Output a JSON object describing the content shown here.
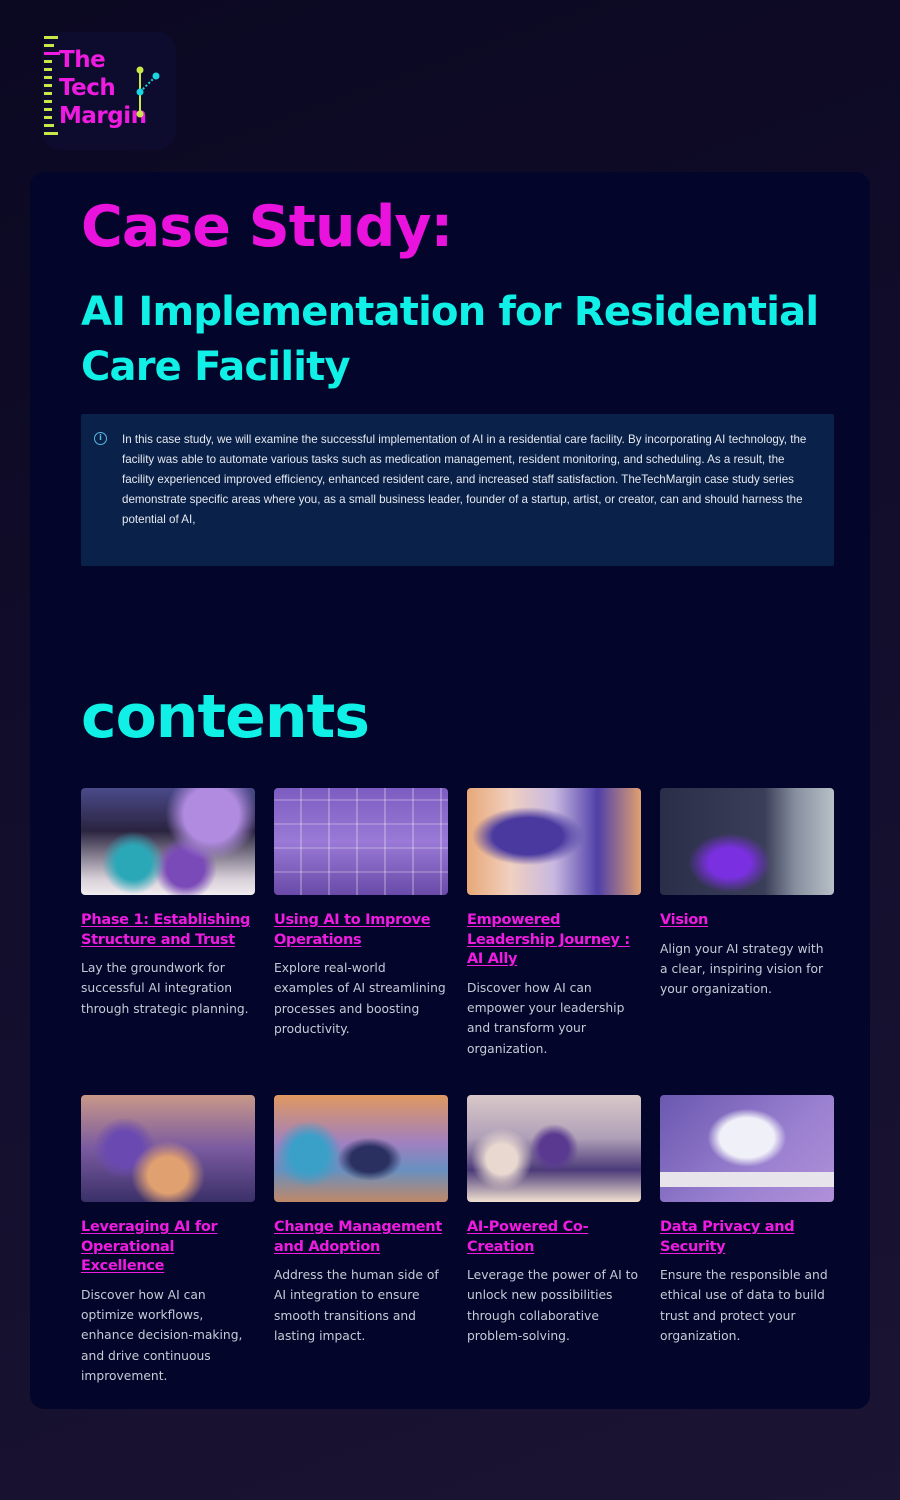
{
  "logo": {
    "lines": [
      "The",
      "Tech",
      "Margin"
    ],
    "colors": {
      "text": "#f01be0",
      "ruler": "#c8e84a",
      "node": "#1ad6e0"
    }
  },
  "header": {
    "title": "Case Study:",
    "subtitle": "AI Implementation for Residential Care Facility",
    "title_color": "#ea12dd",
    "subtitle_color": "#10f0e6"
  },
  "intro": {
    "icon": "info-icon",
    "text": "In this case study, we will examine the successful implementation of AI in a residential care facility. By incorporating AI technology, the facility was able to automate various tasks such as medication management, resident monitoring, and scheduling. As a result, the facility experienced improved efficiency, enhanced resident care, and increased staff satisfaction. TheTechMargin case study series demonstrate specific areas where you, as a small business leader, founder of a startup, artist, or creator, can and should harness the potential of AI,"
  },
  "contents": {
    "heading": "contents",
    "items": [
      {
        "title": "Phase 1: Establishing Structure and Trust",
        "description": "Lay the groundwork for successful AI integration through strategic planning.",
        "image": "seniors-meeting-image"
      },
      {
        "title": "Using AI to Improve Operations",
        "description": "Explore real-world examples of AI streamlining processes and boosting productivity.",
        "image": "dashboard-wall-image"
      },
      {
        "title": "Empowered Leadership Journey : AI Ally",
        "description": "Discover how AI can empower your leadership and transform your organization.",
        "image": "illustrated-office-image"
      },
      {
        "title": "Vision",
        "description": "Align your AI strategy with a clear, inspiring vision for your organization.",
        "image": "modern-office-image"
      },
      {
        "title": "Leveraging AI for Operational Excellence",
        "description": "Discover how AI can optimize workflows, enhance decision-making, and drive continuous improvement.",
        "image": "team-table-image"
      },
      {
        "title": "Change Management and Adoption",
        "description": "Address the human side of AI integration to ensure smooth transitions and lasting impact.",
        "image": "busy-workspace-image"
      },
      {
        "title": "AI-Powered Co-Creation",
        "description": "Leverage the power of AI to unlock new possibilities through collaborative problem-solving.",
        "image": "seniors-laptop-image"
      },
      {
        "title": "Data Privacy and Security",
        "description": "Ensure the responsible and ethical use of data to build trust and protect your organization.",
        "image": "devices-desk-image"
      }
    ]
  }
}
